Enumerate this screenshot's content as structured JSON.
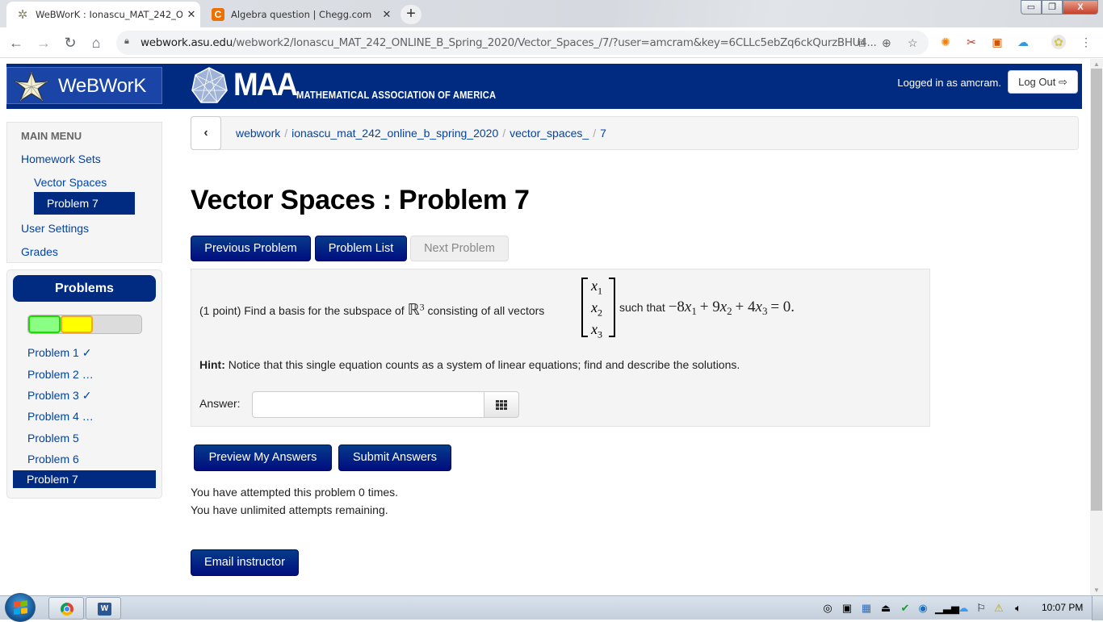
{
  "browser": {
    "tabs": [
      {
        "title": "WeBWorK : Ionascu_MAT_242_O",
        "icon": "webwork-star-icon",
        "active": true
      },
      {
        "title": "Algebra question | Chegg.com",
        "icon": "chegg-icon",
        "favicon_letter": "C",
        "active": false
      }
    ],
    "new_tab_label": "+",
    "close_glyph": "✕",
    "url_host": "webwork.asu.edu",
    "url_path": "/webwork2/Ionascu_MAT_242_ONLINE_B_Spring_2020/Vector_Spaces_/7/?user=amcram&key=6CLLc5ebZq6ckQurzBHU4...",
    "nav": {
      "back": "←",
      "forward": "→",
      "reload": "↻",
      "home": "⌂"
    },
    "window_controls": {
      "minimize": "▭",
      "maximize": "❐",
      "close": "X"
    }
  },
  "header": {
    "webwork_logo_text": "WeBWorK",
    "maa_big": "MAA",
    "maa_small": "MATHEMATICAL ASSOCIATION OF AMERICA",
    "logged_in_text": "Logged in as amcram.",
    "logout_label": "Log Out",
    "logout_icon": "⇨"
  },
  "main_menu": {
    "heading": "MAIN MENU",
    "items": [
      {
        "label": "Homework Sets"
      },
      {
        "label": "Vector Spaces"
      },
      {
        "label": "Problem 7",
        "active": true
      },
      {
        "label": "User Settings"
      },
      {
        "label": "Grades"
      }
    ]
  },
  "problems_panel": {
    "heading": "Problems",
    "progress": {
      "correct_fraction": 0.2857,
      "in_progress_fraction": 0.2857,
      "colors": {
        "correct": "#8bff84",
        "in_progress": "#ffff00",
        "remaining": "#dcdcdc"
      }
    },
    "items": [
      {
        "label": "Problem 1 ✓"
      },
      {
        "label": "Problem 2 …"
      },
      {
        "label": "Problem 3 ✓"
      },
      {
        "label": "Problem 4 …"
      },
      {
        "label": "Problem 5"
      },
      {
        "label": "Problem 6"
      },
      {
        "label": "Problem 7",
        "active": true
      }
    ]
  },
  "breadcrumb": {
    "back_glyph": "‹",
    "items": [
      "webwork",
      "ionascu_mat_242_online_b_spring_2020",
      "vector_spaces_",
      "7"
    ],
    "separator": "/"
  },
  "page_title": "Vector Spaces : Problem 7",
  "nav_buttons": {
    "previous": "Previous Problem",
    "list": "Problem List",
    "next": "Next Problem"
  },
  "problem": {
    "question_prefix": "(1 point) Find a basis for the subspace of ",
    "space_symbol": "ℝ",
    "space_exponent": "3",
    "question_middle": " consisting of all vectors",
    "vector_entries": [
      {
        "var": "x",
        "sub": "1"
      },
      {
        "var": "x",
        "sub": "2"
      },
      {
        "var": "x",
        "sub": "3"
      }
    ],
    "such_that": "such that ",
    "equation": {
      "c1": "−8",
      "c2": "+ 9",
      "c3": "+ 4",
      "rhs": "= 0."
    },
    "hint_label": "Hint:",
    "hint_text": " Notice that this single equation counts as a system of linear equations; find and describe the solutions.",
    "answer_label": "Answer:",
    "answer_value": "",
    "answer_placeholder": ""
  },
  "actions": {
    "preview": "Preview My Answers",
    "submit": "Submit Answers",
    "email": "Email instructor"
  },
  "status": {
    "attempts": "You have attempted this problem 0 times.",
    "remaining": "You have unlimited attempts remaining."
  },
  "taskbar": {
    "clock": "10:07 PM",
    "word_letter": "W"
  },
  "colors": {
    "brand_navy": "#002b80",
    "button_navy": "#000d7f",
    "link_blue": "#0044a8"
  }
}
